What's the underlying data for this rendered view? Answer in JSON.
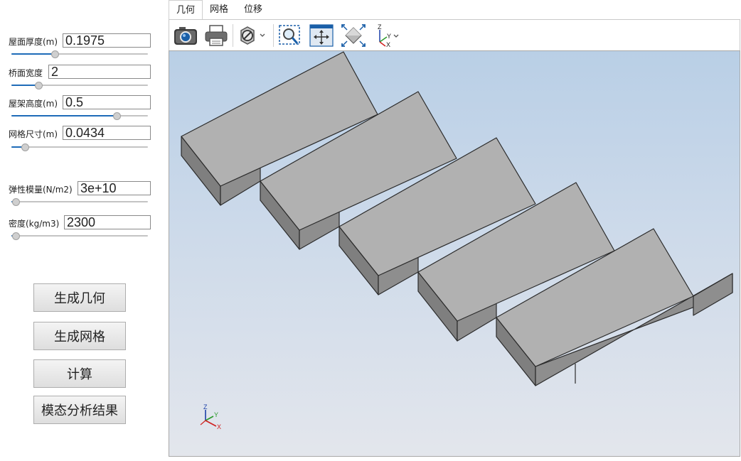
{
  "params": [
    {
      "label": "屋面厚度(m)",
      "value": "0.1975",
      "slider": 0.32
    },
    {
      "label": "桥面宽度",
      "value": "2",
      "slider": 0.2
    },
    {
      "label": "屋架高度(m)",
      "value": "0.5",
      "slider": 0.77
    },
    {
      "label": "网格尺寸(m)",
      "value": "0.0434",
      "slider": 0.1
    },
    {
      "label": "弹性模量(N/m2)",
      "value": "3e+10",
      "slider": 0.0
    },
    {
      "label": "密度(kg/m3)",
      "value": "2300",
      "slider": 0.0
    }
  ],
  "buttons": {
    "geometry": "生成几何",
    "mesh": "生成网格",
    "compute": "计算",
    "modal": "模态分析结果"
  },
  "tabs": [
    {
      "label": "几何",
      "active": true
    },
    {
      "label": "网格",
      "active": false
    },
    {
      "label": "位移",
      "active": false
    }
  ],
  "toolbar": {
    "icons": [
      "camera-icon",
      "printer-icon",
      "display-mode-icon",
      "zoom-window-icon",
      "pan-icon",
      "fit-all-icon",
      "axes-view-icon"
    ]
  },
  "viewport": {
    "axis_labels": {
      "z": "Z",
      "y": "Y",
      "x": "X"
    },
    "toolbar_axis_labels": {
      "z": "Z",
      "y": "Y",
      "x": "X"
    }
  },
  "colors": {
    "top_face": "#b1b1b1",
    "side_face": "#8c8c8c",
    "front_face": "#7a7a7a",
    "slider_fill": "#1e6bb8",
    "bg_top": "#b9cfe6",
    "bg_bottom": "#e3e6ec"
  }
}
